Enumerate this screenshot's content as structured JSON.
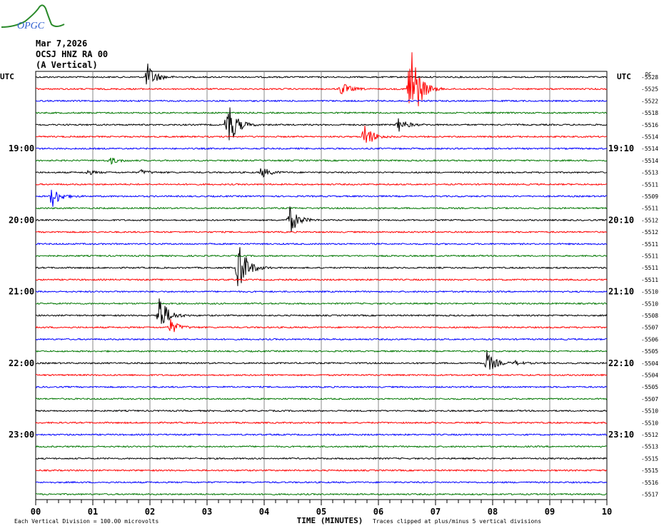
{
  "logo_text": "OPGC",
  "header": {
    "date": "Mar 7,2026",
    "station": "OCSJ HNZ RA 00",
    "component": "(A Vertical)"
  },
  "chart_data": {
    "type": "line",
    "title": "Mar 7,2026 OCSJ HNZ RA 00 (A Vertical)",
    "xlabel": "TIME (MINUTES)",
    "xlim": [
      0,
      10
    ],
    "x_ticks": [
      "00",
      "01",
      "02",
      "03",
      "04",
      "05",
      "06",
      "07",
      "08",
      "09",
      "10"
    ],
    "left_label": "UTC",
    "right_label": "UTC",
    "dc_label": "DC",
    "left_hour_labels": [
      {
        "row": 6,
        "text": "19:00"
      },
      {
        "row": 12,
        "text": "20:00"
      },
      {
        "row": 18,
        "text": "21:00"
      },
      {
        "row": 24,
        "text": "22:00"
      },
      {
        "row": 30,
        "text": "23:00"
      }
    ],
    "right_hour_labels": [
      {
        "row": 6,
        "text": "19:10"
      },
      {
        "row": 12,
        "text": "20:10"
      },
      {
        "row": 18,
        "text": "21:10"
      },
      {
        "row": 24,
        "text": "22:10"
      },
      {
        "row": 30,
        "text": "23:10"
      }
    ],
    "row_minutes": 10,
    "trace_colors": [
      "#000000",
      "#ff0000",
      "#0000ff",
      "#007700"
    ],
    "dc_offsets": [
      -5528,
      -5525,
      -5522,
      -5518,
      -5516,
      -5514,
      -5514,
      -5514,
      -5513,
      -5511,
      -5509,
      -5511,
      -5512,
      -5512,
      -5511,
      -5511,
      -5511,
      -5511,
      -5510,
      -5510,
      -5508,
      -5507,
      -5506,
      -5505,
      -5504,
      -5504,
      -5505,
      -5507,
      -5510,
      -5510,
      -5512,
      -5513,
      -5515,
      -5515,
      -5516,
      -5517
    ],
    "events": [
      {
        "row": 0,
        "minute": 1.95,
        "amplitude_div": 1.2
      },
      {
        "row": 1,
        "minute": 5.35,
        "amplitude_div": 0.6
      },
      {
        "row": 1,
        "minute": 6.55,
        "amplitude_div": 5
      },
      {
        "row": 4,
        "minute": 3.35,
        "amplitude_div": 2.5
      },
      {
        "row": 4,
        "minute": 6.35,
        "amplitude_div": 0.6
      },
      {
        "row": 5,
        "minute": 5.75,
        "amplitude_div": 1.2
      },
      {
        "row": 7,
        "minute": 1.3,
        "amplitude_div": 0.3
      },
      {
        "row": 8,
        "minute": 0.9,
        "amplitude_div": 0.2
      },
      {
        "row": 8,
        "minute": 1.85,
        "amplitude_div": 0.2
      },
      {
        "row": 8,
        "minute": 3.95,
        "amplitude_div": 0.5
      },
      {
        "row": 10,
        "minute": 0.28,
        "amplitude_div": 1.0
      },
      {
        "row": 12,
        "minute": 4.45,
        "amplitude_div": 1.2
      },
      {
        "row": 16,
        "minute": 3.55,
        "amplitude_div": 2.5
      },
      {
        "row": 20,
        "minute": 2.15,
        "amplitude_div": 2.0
      },
      {
        "row": 21,
        "minute": 2.35,
        "amplitude_div": 0.7
      },
      {
        "row": 24,
        "minute": 7.9,
        "amplitude_div": 1.0
      },
      {
        "row": 24,
        "minute": 8.4,
        "amplitude_div": 0.15
      }
    ],
    "footer_left": "Each Vertical Division =  100.00 microvolts",
    "footer_right": "Traces clipped at plus/minus 5 vertical divisions"
  }
}
